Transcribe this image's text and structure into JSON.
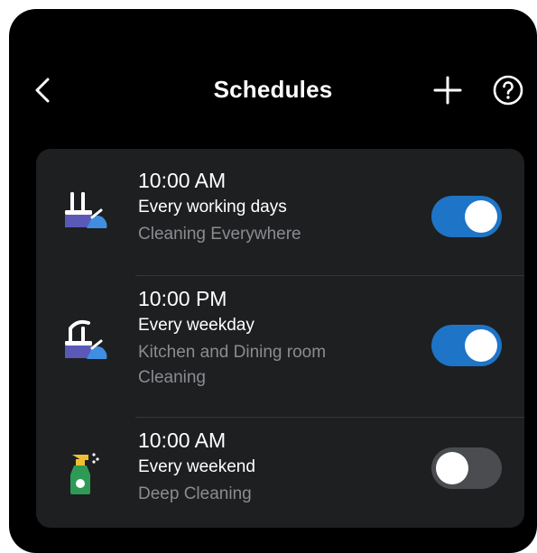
{
  "header": {
    "title": "Schedules",
    "back_icon": "chevron-left-icon",
    "add_icon": "plus-icon",
    "help_icon": "question-circle-icon"
  },
  "colors": {
    "background": "#000000",
    "card": "#1e1f21",
    "toggle_on": "#1e74c6",
    "toggle_off": "#4a4c50",
    "secondary_text": "#8a8c90"
  },
  "schedules": [
    {
      "icon": "vacuum-mop-icon",
      "time": "10:00 AM",
      "days": "Every working days",
      "task": "Cleaning Everywhere",
      "enabled": true
    },
    {
      "icon": "robot-arm-mop-icon",
      "time": "10:00 PM",
      "days": "Every weekday",
      "task": "Kitchen and Dining room\nCleaning",
      "enabled": true
    },
    {
      "icon": "spray-bottle-icon",
      "time": "10:00 AM",
      "days": "Every weekend",
      "task": "Deep Cleaning",
      "enabled": false
    }
  ]
}
